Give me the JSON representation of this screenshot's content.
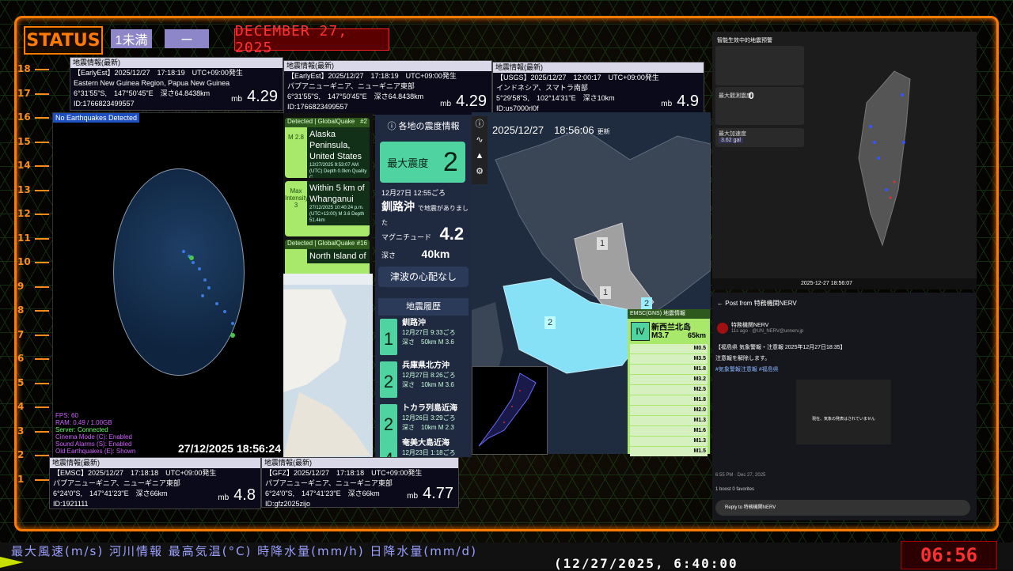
{
  "status": {
    "label": "STATUS",
    "chip1": "1未満",
    "chip2": "ー",
    "date": "DECEMBER 27, 2025"
  },
  "ruler": [
    "18",
    "17",
    "16",
    "15",
    "14",
    "13",
    "12",
    "11",
    "10",
    "9",
    "8",
    "7",
    "6",
    "5",
    "4",
    "3",
    "2",
    "1"
  ],
  "cards": {
    "c1": {
      "hdr": "地震情報(最新)",
      "l1": "【EarlyEst】2025/12/27　17:18:19　UTC+09:00発生",
      "l2": "Eastern New Guinea Region, Papua New Guinea",
      "l3": "6°31'55\"S,　147°50'45\"E　深さ64.8438km",
      "l4": "ID:1766823499557",
      "unit": "mb",
      "mag": "4.29"
    },
    "c2": {
      "hdr": "地震情報(最新)",
      "l1": "【EarlyEst】2025/12/27　17:18:19　UTC+09:00発生",
      "l2": "パプアニューギニア、ニューギニア東部",
      "l3": "6°31'55\"S,　147°50'45\"E　深さ64.8438km",
      "l4": "ID:1766823499557",
      "unit": "mb",
      "mag": "4.29"
    },
    "c3": {
      "hdr": "地震情報(最新)",
      "l1": "【USGS】2025/12/27　12:00:17　UTC+09:00発生",
      "l2": "インドネシア、スマトラ南部",
      "l3": "5°29'58\"S,　102°14'31\"E　深さ10km",
      "l4": "ID:us7000rl0f",
      "unit": "mb",
      "mag": "4.9"
    },
    "c4": {
      "hdr": "地震情報(最新)",
      "l1": "【EMSC】2025/12/27　17:18:18　UTC+09:00発生",
      "l2": "パプアニューギニア、ニューギニア東部",
      "l3": "6°24'0\"S,　147°41'23\"E　深さ66km",
      "l4": "ID:1921111",
      "unit": "mb",
      "mag": "4.8"
    },
    "c5": {
      "hdr": "地震情報(最新)",
      "l1": "【GFZ】2025/12/27　17:18:18　UTC+09:00発生",
      "l2": "パプアニューギニア、ニューギニア東部",
      "l3": "6°24'0\"S,　147°41'23\"E　深さ66km",
      "l4": "ID:gfz2025zijo",
      "unit": "mb",
      "mag": "4.77"
    }
  },
  "globe_panel": {
    "label": "No Earthquakes Detected",
    "stats": [
      "FPS: 60",
      "RAM: 0.49 / 1.00GB",
      "Server: Connected",
      "Cinema Mode (C): Enabled",
      "Sound Alarms (S): Enabled",
      "Old Earthquakes (E): Shown"
    ],
    "time": "27/12/2025 18:56:24"
  },
  "gq": [
    {
      "top": "Detected | GlobalQuake",
      "no": "#2",
      "m": "M 2.8",
      "title": "Alaska Peninsula, United States",
      "sub": "12/27/2025 9:53:07 AM (UTC)  Depth 0.0km  Quality C"
    },
    {
      "top": "",
      "no": "",
      "m": "Max Intensity 3",
      "title": "Within 5 km of Whanganui",
      "sub": "27/12/2025 10:40:24 p.m. (UTC+13:00)  M 3.6  Depth 51.4km"
    },
    {
      "top": "Detected | GlobalQuake",
      "no": "#16",
      "m": "",
      "title": "North Island of",
      "sub": ""
    }
  ],
  "shindo": {
    "title": "ⓘ 各地の震度情報",
    "max_label": "最大震度",
    "max_value": "2",
    "time": "12月27日 12:55ごろ",
    "place": "釧路沖",
    "place_suffix": "で地震がありました",
    "mag_label": "マグニチュード",
    "mag": "4.2",
    "depth_label": "深さ",
    "depth": "40km",
    "tsunami": "津波の心配なし",
    "hist_title": "地震履歴",
    "history": [
      {
        "level": "1",
        "place": "釧路沖",
        "time": "12月27日 9:33ごろ",
        "depth": "深さ　50km",
        "mag": "M 3.6"
      },
      {
        "level": "2",
        "place": "兵庫県北方沖",
        "time": "12月27日 8:26ごろ",
        "depth": "深さ　10km",
        "mag": "M 3.6"
      },
      {
        "level": "2",
        "place": "トカラ列島近海",
        "time": "12月26日 3:29ごろ",
        "depth": "深さ　10km",
        "mag": "M 2.3"
      },
      {
        "level": "4",
        "place": "奄美大島近海",
        "time": "12月23日 1:18ごろ",
        "depth": "",
        "mag": ""
      }
    ]
  },
  "jmap": {
    "time": "2025/12/27　18:56:06",
    "time_suffix": "更新",
    "labels": [
      "1",
      "1",
      "2",
      "2"
    ]
  },
  "emsc": {
    "hdr": "EMSC(GNS) 地震情報",
    "level": "IV",
    "place": "新西兰北岛",
    "mag": "M3.7",
    "depth": "65km",
    "list": [
      [
        "M0.5"
      ],
      [
        "M3.5"
      ],
      [
        "M1.8"
      ],
      [
        "M3.2"
      ],
      [
        "M2.5"
      ],
      [
        "M1.8"
      ],
      [
        "M2.0"
      ],
      [
        "M1.3"
      ],
      [
        "M1.6"
      ],
      [
        "M1.3"
      ],
      [
        "M1.5"
      ]
    ]
  },
  "tw": {
    "title": "智能生效中的地震预警",
    "max_label": "最大觀測震度",
    "max": "0",
    "station": "最大加速度",
    "gal": "3.62 gal",
    "footer_time": "2025-12-27 18:56:07"
  },
  "nerv": {
    "post_from": "Post from 特務機関NERV",
    "name": "特務機関NERV",
    "handle": "11s ago · @UN_NERV@unnerv.jp",
    "line1": "【福島県 気象警報・注意報 2025年12月27日18:35】",
    "line2": "注意報を解除します。",
    "tags": "#気象警報注意報 #福島県",
    "img_text": "現在、気象の発表はされていません",
    "date": "6:55 PM · Dec 27, 2025",
    "counts": "1 boost  0 favorites",
    "reply": "Reply to 特務機関NERV"
  },
  "bottom": {
    "headers": "最大風速(m/s)  河川情報     最高気温(°C)     時降水量(mm/h)    日降水量(mm/d)",
    "time": "(12/27/2025, 6:40:00",
    "clock": "06:56"
  }
}
